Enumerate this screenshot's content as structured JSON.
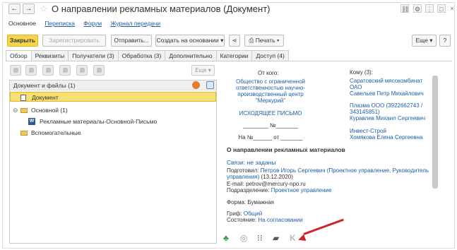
{
  "window": {
    "title": "О направлении рекламных материалов (Документ)"
  },
  "nav": {
    "links": [
      "Основное",
      "Переписка",
      "Форум",
      "Журнал передачи"
    ]
  },
  "toolbar": {
    "close_label": "Закрыть",
    "register_label": "Зарегистрировать",
    "send_label": "Отправить...",
    "create_based_label": "Создать на основании",
    "print_label": "Печать",
    "more_label": "Еще",
    "help_label": "?"
  },
  "tabs": [
    "Обзор",
    "Реквизиты",
    "Получатели (3)",
    "Обработка (3)",
    "Дополнительно",
    "Категории",
    "Доступ (4)"
  ],
  "files_toolbar": {
    "more_label": "Еще"
  },
  "files": {
    "header": "Документ и файлы (1)",
    "rows": [
      {
        "label": "Документ"
      },
      {
        "label": "Основной (1)"
      },
      {
        "label": "Рекламные материалы-Основной-Письмо"
      },
      {
        "label": "Вспомогательные"
      }
    ]
  },
  "preview": {
    "from_label": "От кого:",
    "from_org": [
      "Общество с ограниченной",
      "ответственностью научно-",
      "производственный центр",
      "\"Меркурий\""
    ],
    "outgoing": "ИСХОДЯЩЕЕ ПИСЬМО",
    "number_line": "________ №_______",
    "ref_line": "На №______ от _______",
    "to_label": "Кому (3):",
    "recipients": [
      [
        "Саратовский мясокомбинат",
        "ОАО",
        "Савельев Петр Михайлович"
      ],
      [
        "Плазма ООО (3922662743 /",
        "343145851)",
        "Куравлев Михаил Сергеевич"
      ],
      [
        "Инвест-Строй",
        "Хомякова Елена Сергеевна"
      ]
    ],
    "subject": "О направлении рекламных материалов",
    "links_label": "Связи: не заданы",
    "prepared_label": "Подготовил:",
    "prepared_value": "Петров Игорь Сергеевич (Проектное управление, Руководитель",
    "prepared_value2": "управления)",
    "prepared_date": "(13.12.2020)",
    "email_label": "E-mail:",
    "email_value": "petrov@mercury-npo.ru",
    "dept_label": "Подразделение:",
    "dept_value": "Проектное управление",
    "form_label": "Форма:",
    "form_value": "Бумажная",
    "grif_label": "Гриф:",
    "grif_value": "Общий",
    "status_label": "Состояние:",
    "status_value": "На согласовании"
  },
  "colors": {
    "primary_button": "#f7d549",
    "link": "#1a5fa8",
    "selection": "#f8df72",
    "arrow": "#d1202a"
  }
}
